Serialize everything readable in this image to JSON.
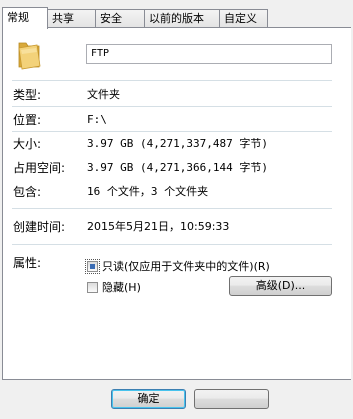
{
  "tabs": [
    {
      "label": "常规"
    },
    {
      "label": "共享"
    },
    {
      "label": "安全"
    },
    {
      "label": "以前的版本"
    },
    {
      "label": "自定义"
    }
  ],
  "name_field": {
    "value": "FTP"
  },
  "properties": {
    "type_label": "类型:",
    "type_value": "文件夹",
    "location_label": "位置:",
    "location_value": "F:\\",
    "size_label": "大小:",
    "size_value": "3.97 GB (4,271,337,487 字节)",
    "disk_size_label": "占用空间:",
    "disk_size_value": "3.97 GB (4,271,366,144 字节)",
    "contains_label": "包含:",
    "contains_value": "16 个文件，3 个文件夹",
    "created_label": "创建时间:",
    "created_value": "2015年5月21日，10:59:33",
    "attributes_label": "属性:"
  },
  "attributes": {
    "readonly_label": "只读(仅应用于文件夹中的文件)(R)",
    "readonly_state": "indeterminate",
    "hidden_label": "隐藏(H)",
    "hidden_state": "unchecked",
    "advanced_label": "高级(D)..."
  },
  "footer": {
    "ok_label": "确定"
  },
  "colors": {
    "panel_bg": "#ffffff",
    "dialog_bg": "#f0f0f0",
    "separator": "#d5dfe5",
    "checkbox_fill": "#3a6cb4"
  }
}
